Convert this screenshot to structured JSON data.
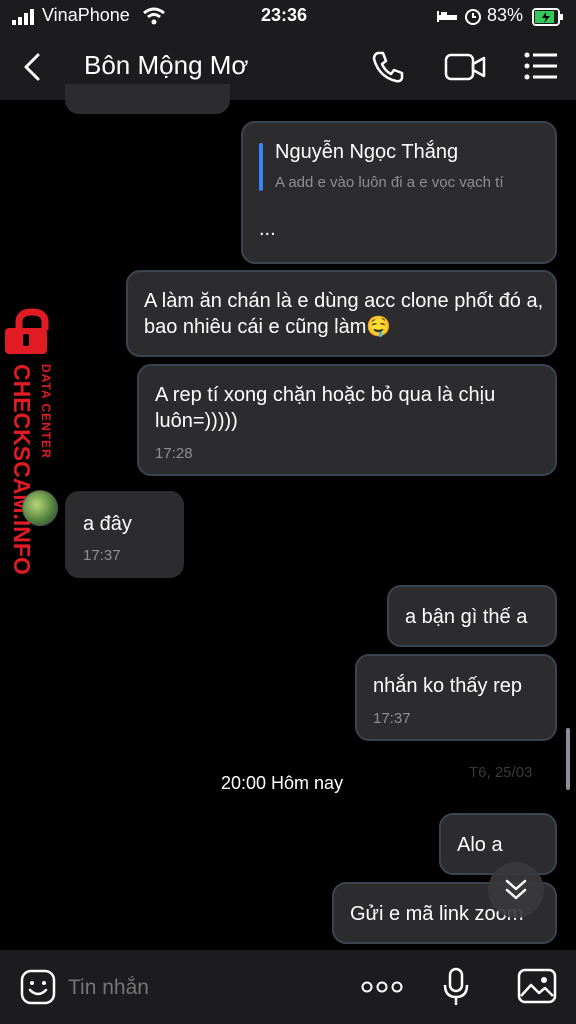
{
  "status_bar": {
    "carrier": "VinaPhone",
    "time": "23:36",
    "battery": "83%"
  },
  "header": {
    "title": "Bôn Mộng Mơ"
  },
  "messages": [
    {
      "quote_author": "Nguyễn Ngọc Thắng",
      "quote_text": "A add e vào luôn đi a e vọc vạch tí",
      "text": "..."
    },
    {
      "text": "A làm ăn chán là e dùng acc clone phốt đó a, bao nhiêu cái e cũng làm🤤"
    },
    {
      "text": "A rep tí xong chặn hoặc bỏ qua là chịu luôn=)))))",
      "time": "17:28"
    },
    {
      "text": "a đây",
      "time": "17:37"
    },
    {
      "text": "a bận gì thế a"
    },
    {
      "text": "nhắn ko thấy rep",
      "time": "17:37"
    },
    {
      "text": "Alo a"
    },
    {
      "text": "Gửi e mã link zoom"
    }
  ],
  "date_divider": "20:00 Hôm nay",
  "faded_date": "T6, 25/03",
  "watermark": {
    "top": "DATA CENTER",
    "main": "CHECKSCAM.INFO",
    "color": "#e01b24"
  },
  "input": {
    "placeholder": "Tin nhắn"
  },
  "icons": [
    "back-icon",
    "phone-icon",
    "video-icon",
    "menu-icon",
    "sticker-icon",
    "more-icon",
    "mic-icon",
    "image-icon",
    "scroll-down-icon"
  ]
}
